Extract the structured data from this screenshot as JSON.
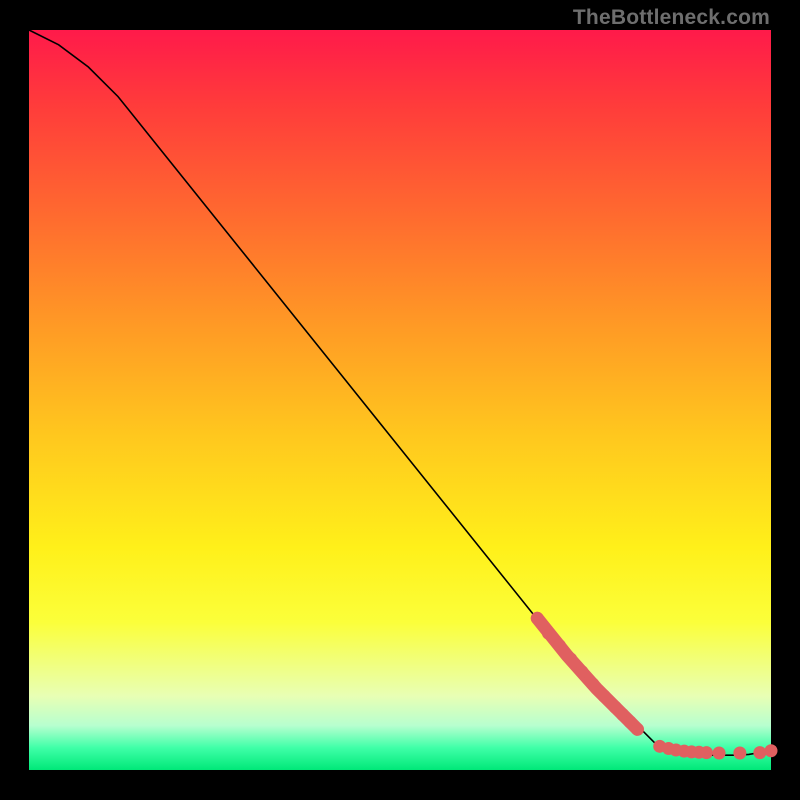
{
  "watermark": "TheBottleneck.com",
  "chart_data": {
    "type": "line",
    "title": "",
    "xlabel": "",
    "ylabel": "",
    "xlim": [
      0,
      100
    ],
    "ylim": [
      0,
      100
    ],
    "series": [
      {
        "name": "curve",
        "style": "line",
        "color": "#000000",
        "x": [
          0,
          4,
          8,
          12,
          16,
          20,
          24,
          28,
          32,
          36,
          40,
          44,
          48,
          52,
          56,
          60,
          64,
          68,
          72,
          76,
          80,
          84,
          85,
          87,
          89,
          91,
          93,
          95,
          97,
          100
        ],
        "y": [
          100,
          98,
          95,
          91,
          86,
          81,
          76,
          71,
          66,
          61,
          56,
          51,
          46,
          41,
          36,
          31,
          26,
          21,
          16,
          12,
          8,
          4,
          3,
          2.4,
          2.1,
          2.0,
          2.0,
          2.0,
          2.1,
          2.6
        ]
      },
      {
        "name": "highlight-segment",
        "style": "thick-line",
        "color": "#e06060",
        "x": [
          68.5,
          72.5,
          76.5,
          79.5,
          82.0
        ],
        "y": [
          20.5,
          15.5,
          11.0,
          8.0,
          5.5
        ]
      },
      {
        "name": "highlight-dots",
        "style": "dots",
        "color": "#e06060",
        "x": [
          68.5,
          70.0,
          71.5,
          73.0,
          74.5,
          76.0,
          77.5,
          79.0,
          80.0,
          81.0,
          82.0,
          85.0,
          86.2,
          87.2,
          88.3,
          89.3,
          90.3,
          91.3,
          93.0,
          95.8,
          98.5,
          100.0
        ],
        "y": [
          20.5,
          18.5,
          16.8,
          15.0,
          13.3,
          11.6,
          10.0,
          8.5,
          7.5,
          6.5,
          5.5,
          3.2,
          2.9,
          2.7,
          2.55,
          2.45,
          2.4,
          2.35,
          2.3,
          2.3,
          2.35,
          2.6
        ]
      }
    ]
  }
}
